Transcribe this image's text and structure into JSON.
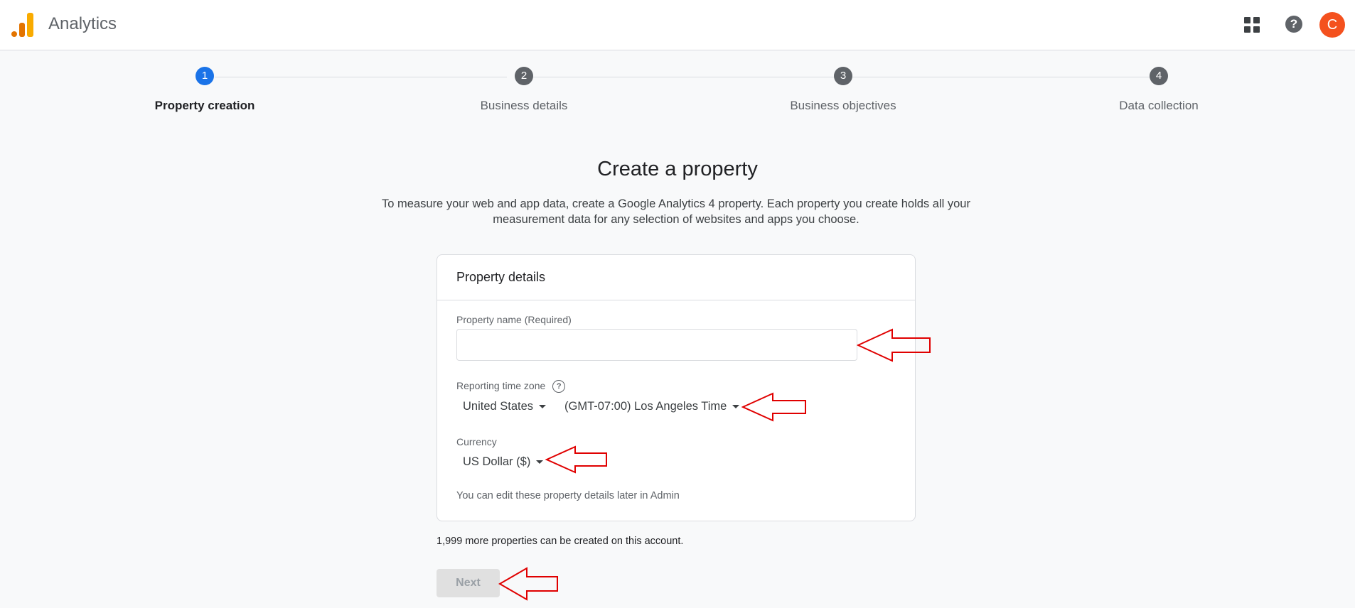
{
  "header": {
    "app_title": "Analytics",
    "avatar_letter": "C",
    "help_glyph": "?"
  },
  "stepper": {
    "steps": [
      {
        "number": "1",
        "label": "Property creation",
        "active": true
      },
      {
        "number": "2",
        "label": "Business details",
        "active": false
      },
      {
        "number": "3",
        "label": "Business objectives",
        "active": false
      },
      {
        "number": "4",
        "label": "Data collection",
        "active": false
      }
    ]
  },
  "main": {
    "title": "Create a property",
    "description": "To measure your web and app data, create a Google Analytics 4 property. Each property you create holds all your measurement data for any selection of websites and apps you choose."
  },
  "card": {
    "title": "Property details",
    "property_name_label": "Property name (Required)",
    "property_name_value": "",
    "time_zone_label": "Reporting time zone",
    "time_zone_help": "?",
    "country_value": "United States",
    "time_zone_value": "(GMT-07:00) Los Angeles Time",
    "currency_label": "Currency",
    "currency_value": "US Dollar ($)",
    "note": "You can edit these property details later in Admin"
  },
  "footer": {
    "remaining_text": "1,999 more properties can be created on this account.",
    "next_label": "Next"
  },
  "colors": {
    "accent": "#1a73e8",
    "avatar": "#f4511e",
    "annotation": "#e00000"
  }
}
